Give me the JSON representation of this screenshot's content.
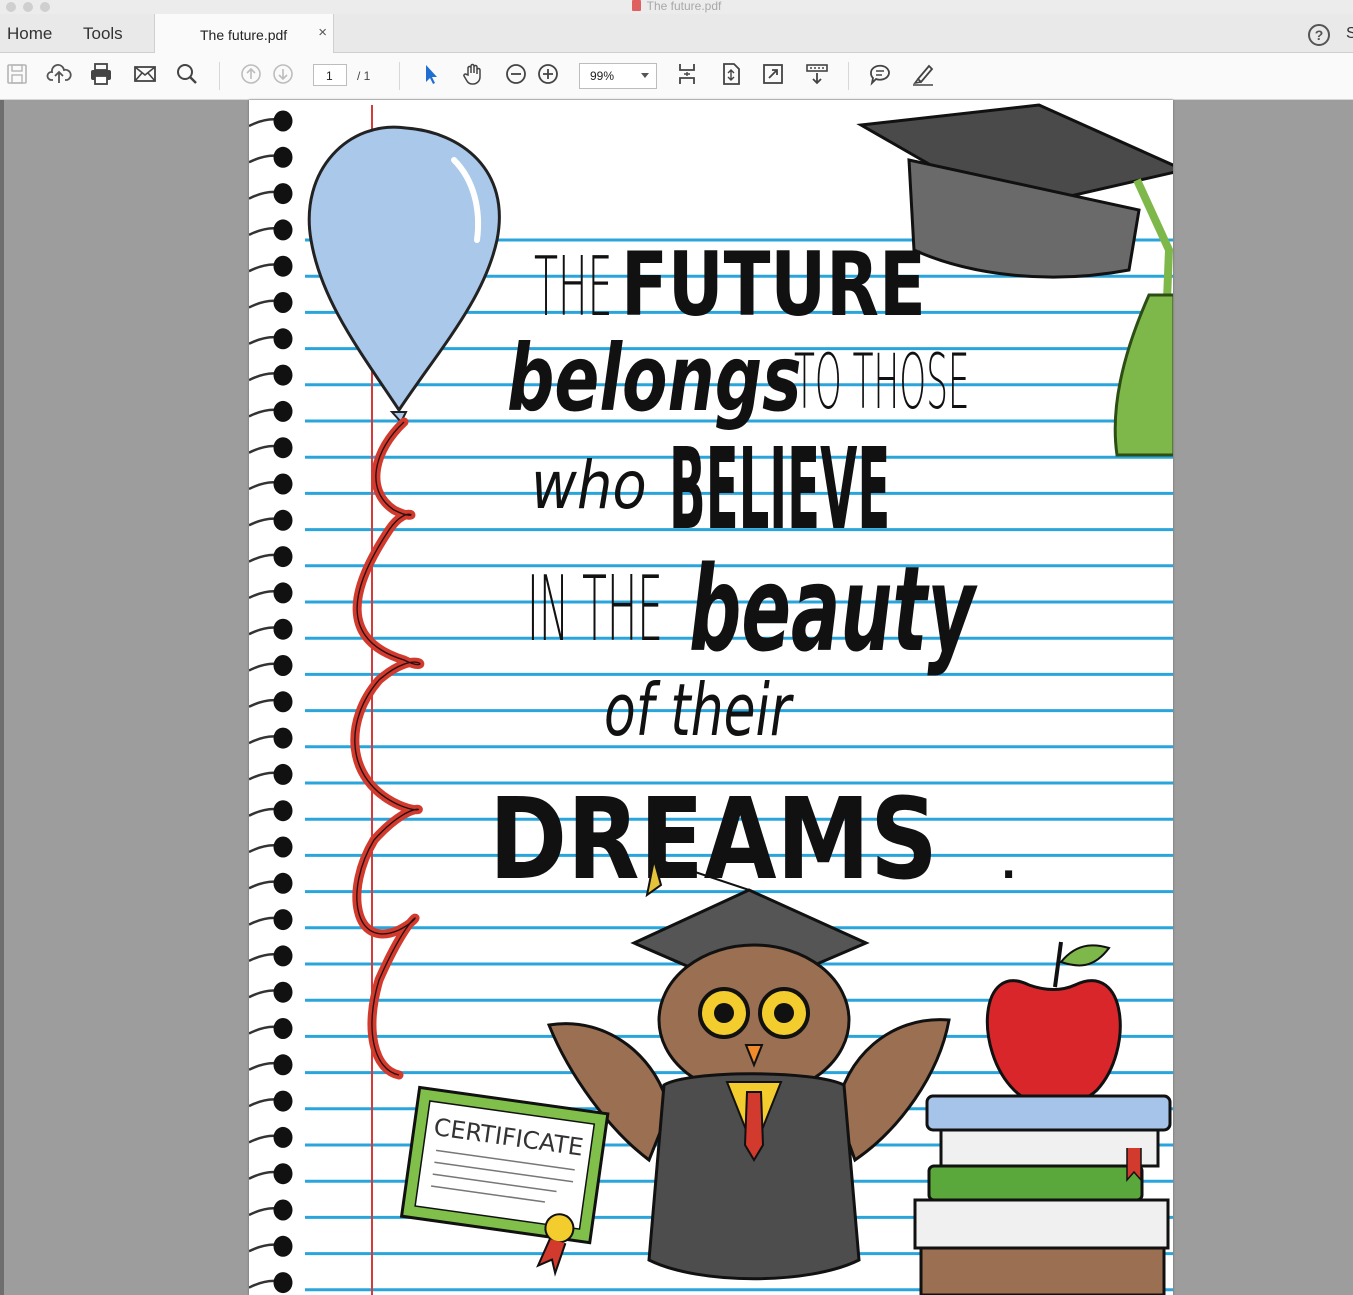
{
  "window": {
    "title": "The future.pdf"
  },
  "nav": {
    "home": "Home",
    "tools": "Tools"
  },
  "tab": {
    "label": "The future.pdf",
    "close": "×"
  },
  "toolbar": {
    "page_current": "1",
    "page_total": "/ 1",
    "zoom": "99%",
    "icons": [
      "save-icon",
      "cloud-upload-icon",
      "print-icon",
      "email-icon",
      "search-icon",
      "page-up-icon",
      "page-down-icon",
      "select-pointer-icon",
      "hand-tool-icon",
      "zoom-out-icon",
      "zoom-in-icon",
      "scroll-mode-icon",
      "fit-page-icon",
      "full-screen-icon",
      "read-mode-icon",
      "comment-icon",
      "highlight-pen-icon"
    ]
  },
  "document": {
    "lines": [
      {
        "text": "THE",
        "style": "thin"
      },
      {
        "text": "FUTURE",
        "style": "bold"
      },
      {
        "text": "belongs",
        "style": "script"
      },
      {
        "text": "TO THOSE",
        "style": "thin"
      },
      {
        "text": "who",
        "style": "script-thin"
      },
      {
        "text": "BELIEVE",
        "style": "bold"
      },
      {
        "text": "IN THE",
        "style": "thin"
      },
      {
        "text": "beauty",
        "style": "script"
      },
      {
        "text": "of their",
        "style": "script-thin"
      },
      {
        "text": "DREAMS",
        "style": "bold"
      },
      {
        "text": ".",
        "style": "bold"
      }
    ],
    "certificate_label": "CERTIFICATE",
    "colors": {
      "rule_blue": "#2aa5dc",
      "margin_red": "#d43b3b",
      "balloon": "#a9c8ea",
      "string": "#d23a2e",
      "apple": "#d8262b"
    }
  }
}
